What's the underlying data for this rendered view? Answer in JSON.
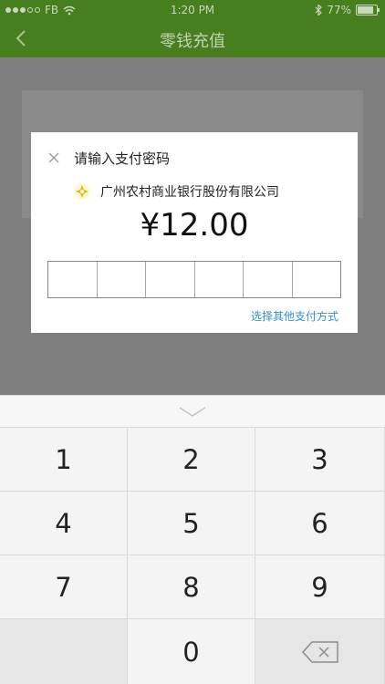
{
  "status_bar": {
    "carrier": "FB",
    "time": "1:20 PM",
    "battery": "77%"
  },
  "nav": {
    "title": "零钱充值",
    "back_icon": "chevron-left-icon"
  },
  "dialog": {
    "title": "请输入支付密码",
    "close_icon": "close-icon",
    "bank_name": "广州农村商业银行股份有限公司",
    "bank_logo": "bank-logo-icon",
    "amount": "¥12.00",
    "password_cells": 6,
    "other_payment_link": "选择其他支付方式"
  },
  "keyboard": {
    "collapse_icon": "chevron-down-icon",
    "keys": [
      "1",
      "2",
      "3",
      "4",
      "5",
      "6",
      "7",
      "8",
      "9",
      "",
      "0",
      "backspace"
    ]
  },
  "colors": {
    "nav_bg_dimmed": "#477f1f",
    "overlay": "#7f7f7f",
    "link": "#2e8fd8"
  }
}
